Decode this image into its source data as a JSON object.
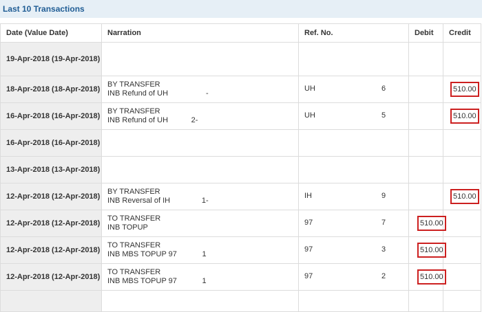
{
  "panel": {
    "title": "Last 10 Transactions"
  },
  "columns": {
    "date": "Date (Value Date)",
    "narration": "Narration",
    "ref": "Ref. No.",
    "debit": "Debit",
    "credit": "Credit"
  },
  "rows": [
    {
      "date": "19-Apr-2018 (19-Apr-2018)",
      "nar1": "",
      "nar2": "",
      "ref_a": "",
      "ref_b": "",
      "debit": "",
      "credit": ""
    },
    {
      "date": "18-Apr-2018 (18-Apr-2018)",
      "nar1": "BY TRANSFER",
      "nar2": "INB Refund of UH                  -",
      "ref_a": "UH",
      "ref_b": "6",
      "debit": "",
      "credit": "510.00"
    },
    {
      "date": "16-Apr-2018 (16-Apr-2018)",
      "nar1": "BY TRANSFER",
      "nar2": "INB Refund of UH           2-",
      "ref_a": "UH",
      "ref_b": "5",
      "debit": "",
      "credit": "510.00"
    },
    {
      "date": "16-Apr-2018 (16-Apr-2018)",
      "nar1": "",
      "nar2": "",
      "ref_a": "",
      "ref_b": "",
      "debit": "",
      "credit": ""
    },
    {
      "date": "13-Apr-2018 (13-Apr-2018)",
      "nar1": "",
      "nar2": "",
      "ref_a": "",
      "ref_b": "",
      "debit": "",
      "credit": ""
    },
    {
      "date": "12-Apr-2018 (12-Apr-2018)",
      "nar1": "BY TRANSFER",
      "nar2": "INB Reversal of IH               1-",
      "ref_a": "IH",
      "ref_b": "9",
      "debit": "",
      "credit": "510.00"
    },
    {
      "date": "12-Apr-2018 (12-Apr-2018)",
      "nar1": "TO TRANSFER",
      "nar2": "INB TOPUP",
      "ref_a": "97",
      "ref_b": "7",
      "debit": "510.00",
      "credit": ""
    },
    {
      "date": "12-Apr-2018 (12-Apr-2018)",
      "nar1": "TO TRANSFER",
      "nar2": "INB MBS TOPUP 97            1",
      "ref_a": "97",
      "ref_b": "3",
      "debit": "510.00",
      "credit": ""
    },
    {
      "date": "12-Apr-2018 (12-Apr-2018)",
      "nar1": "TO TRANSFER",
      "nar2": "INB MBS TOPUP 97            1",
      "ref_a": "97",
      "ref_b": "2",
      "debit": "510.00",
      "credit": ""
    }
  ]
}
